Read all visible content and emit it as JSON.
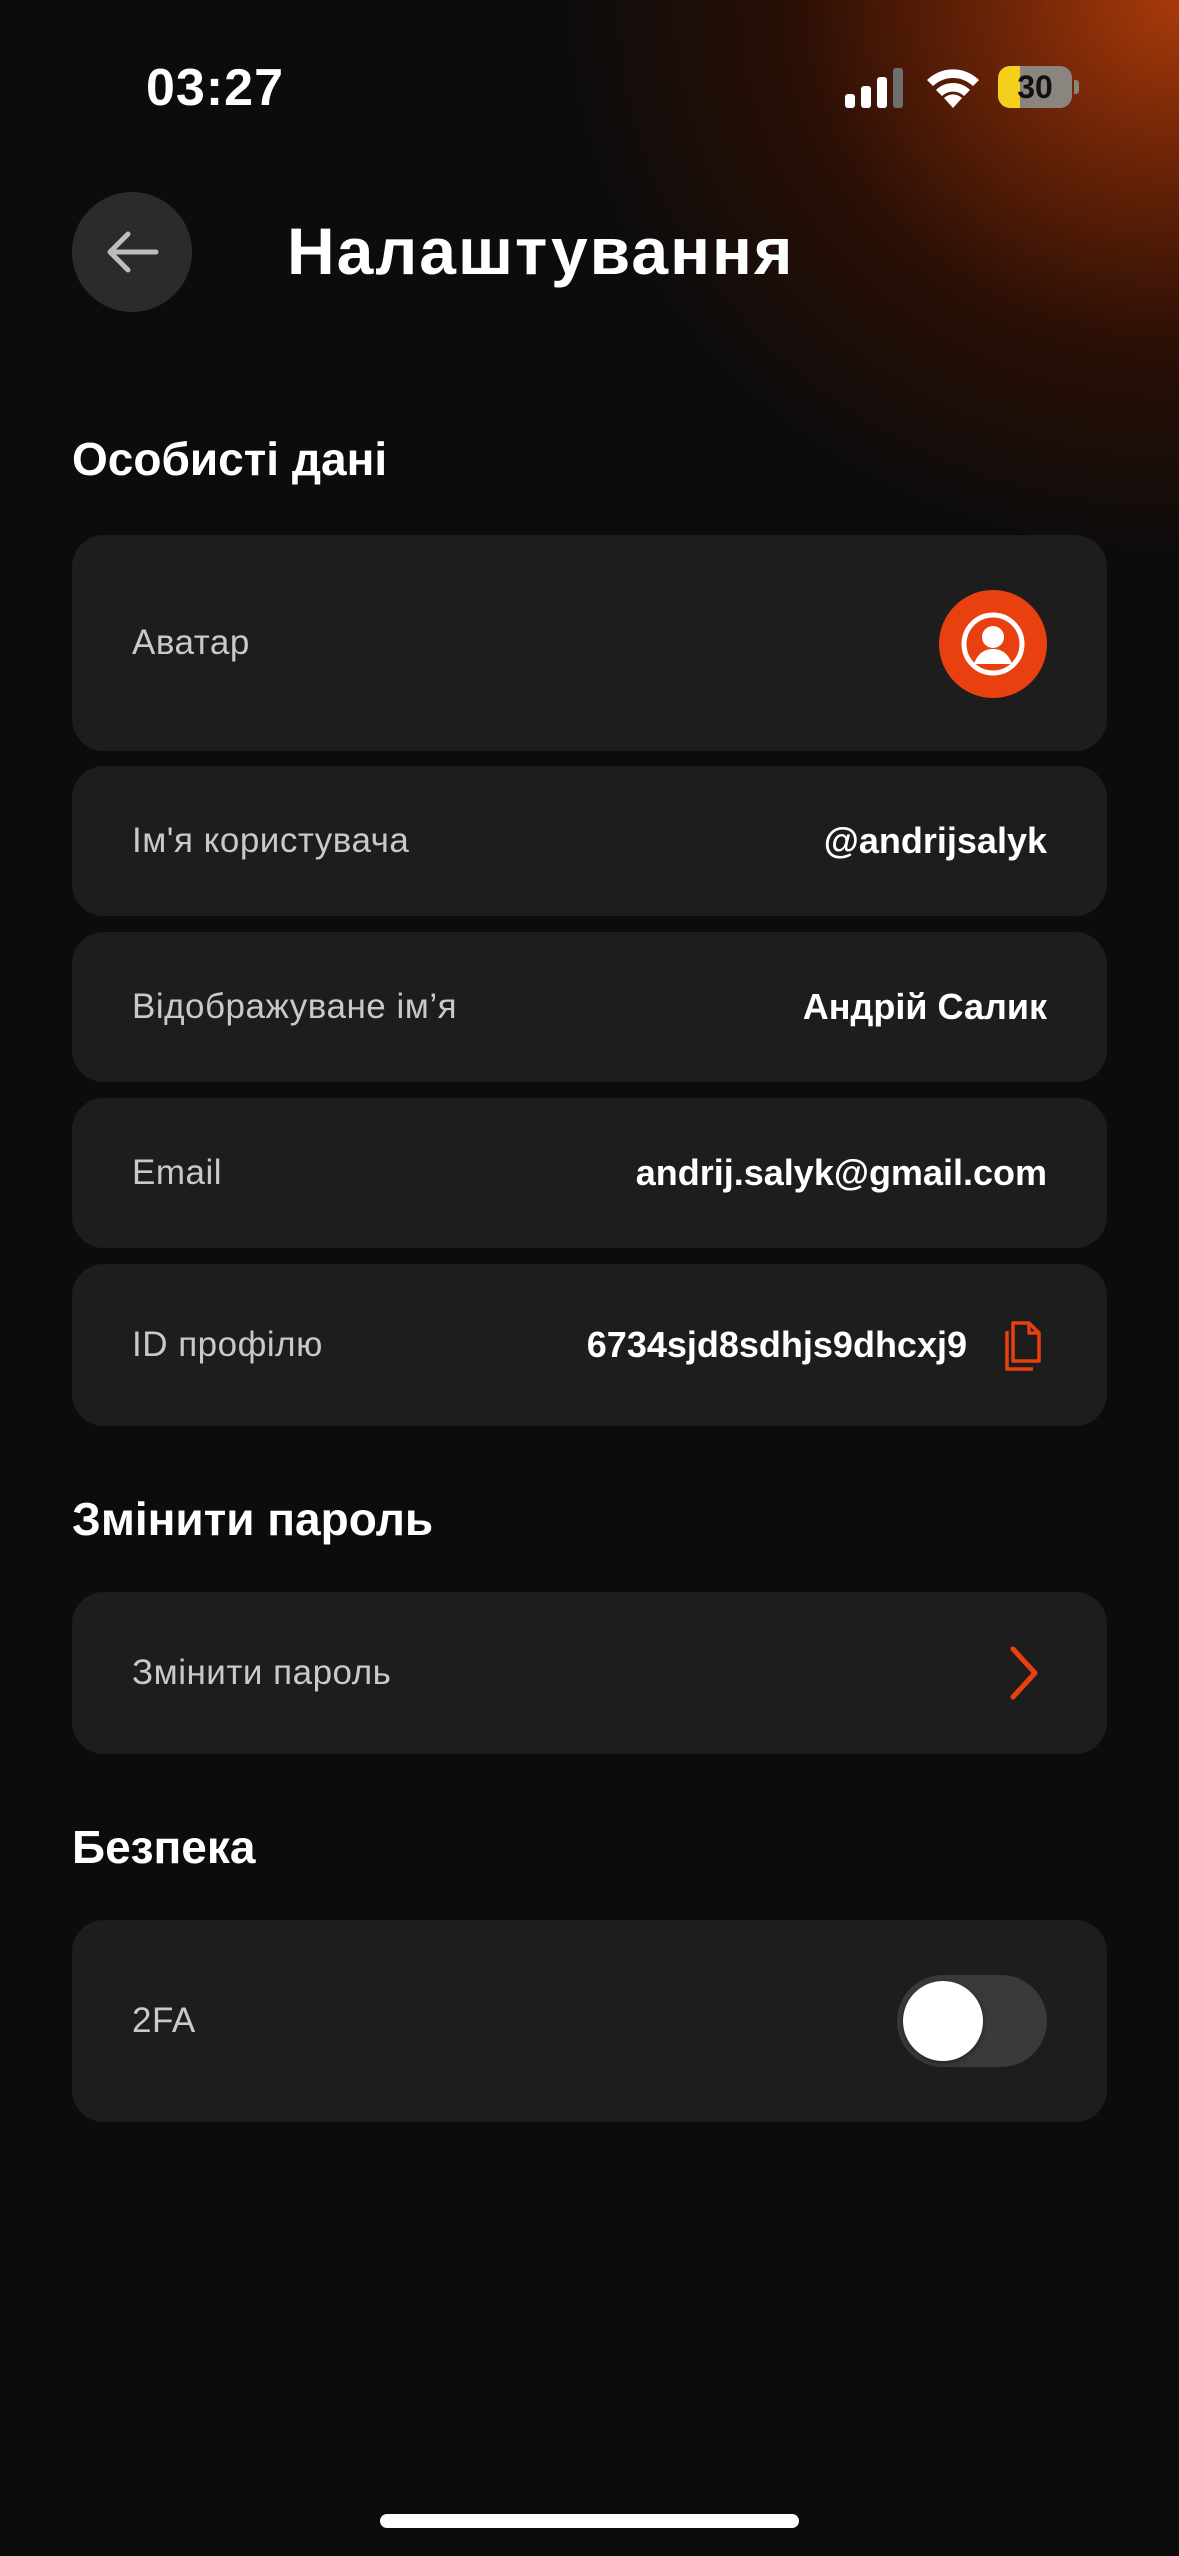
{
  "status_bar": {
    "time": "03:27",
    "battery_level": "30",
    "battery_fraction": 0.3
  },
  "header": {
    "title": "Налаштування",
    "back_icon": "arrow-left-icon"
  },
  "sections": {
    "personal": {
      "title": "Особисті дані",
      "avatar_label": "Аватар",
      "username_label": "Ім'я користувача",
      "username_value": "@andrijsalyk",
      "display_name_label": "Відображуване ім’я",
      "display_name_value": "Андрій Салик",
      "email_label": "Email",
      "email_value": "andrij.salyk@gmail.com",
      "profile_id_label": "ID профілю",
      "profile_id_value": "6734sjd8sdhjs9dhcxj9"
    },
    "password": {
      "title": "Змінити пароль",
      "change_label": "Змінити пароль"
    },
    "security": {
      "title": "Безпека",
      "twofa_label": "2FA",
      "twofa_enabled": false
    }
  },
  "colors": {
    "accent": "#e8410f",
    "background": "#0c0c0c",
    "card": "#1d1d1e",
    "toggle_off": "#3a3a3c"
  }
}
